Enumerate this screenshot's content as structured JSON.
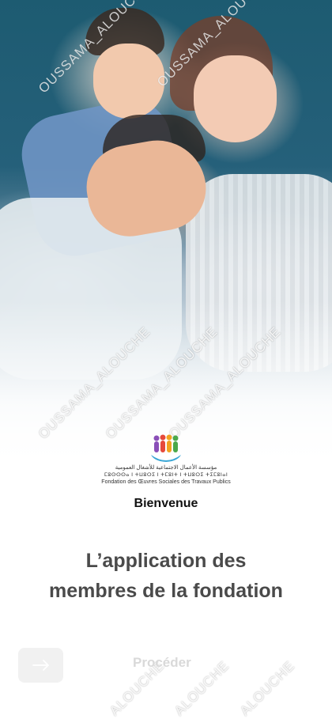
{
  "logo": {
    "arabic_line": "مؤسسة الأعمال الاجتماعية للأشغال العمومية",
    "tifinagh_line": "ⵎⵓⵙⵙⵙⴰ ⵏ ⵜⵡⵓⵔⵉ ⵏ ⵜⵎⵓⵏⵜ ⵏ ⵜⵡⵓⵔⵉ ⵜⵉⵎⵓⵏⴰⵏ",
    "french_line": "Fondation des Œuvres Sociales des Travaux Publics",
    "colors": [
      "#e64a3b",
      "#f2a21f",
      "#3aa7d6",
      "#8a4fb8",
      "#4aa84a"
    ]
  },
  "welcome": "Bienvenue",
  "headline_line1": "L’application des",
  "headline_line2": "membres de la fondation",
  "proceed_label": "Procéder",
  "watermark": "OUSSAMA_ALOUCHE",
  "watermark_partial": "ALOUCHE"
}
